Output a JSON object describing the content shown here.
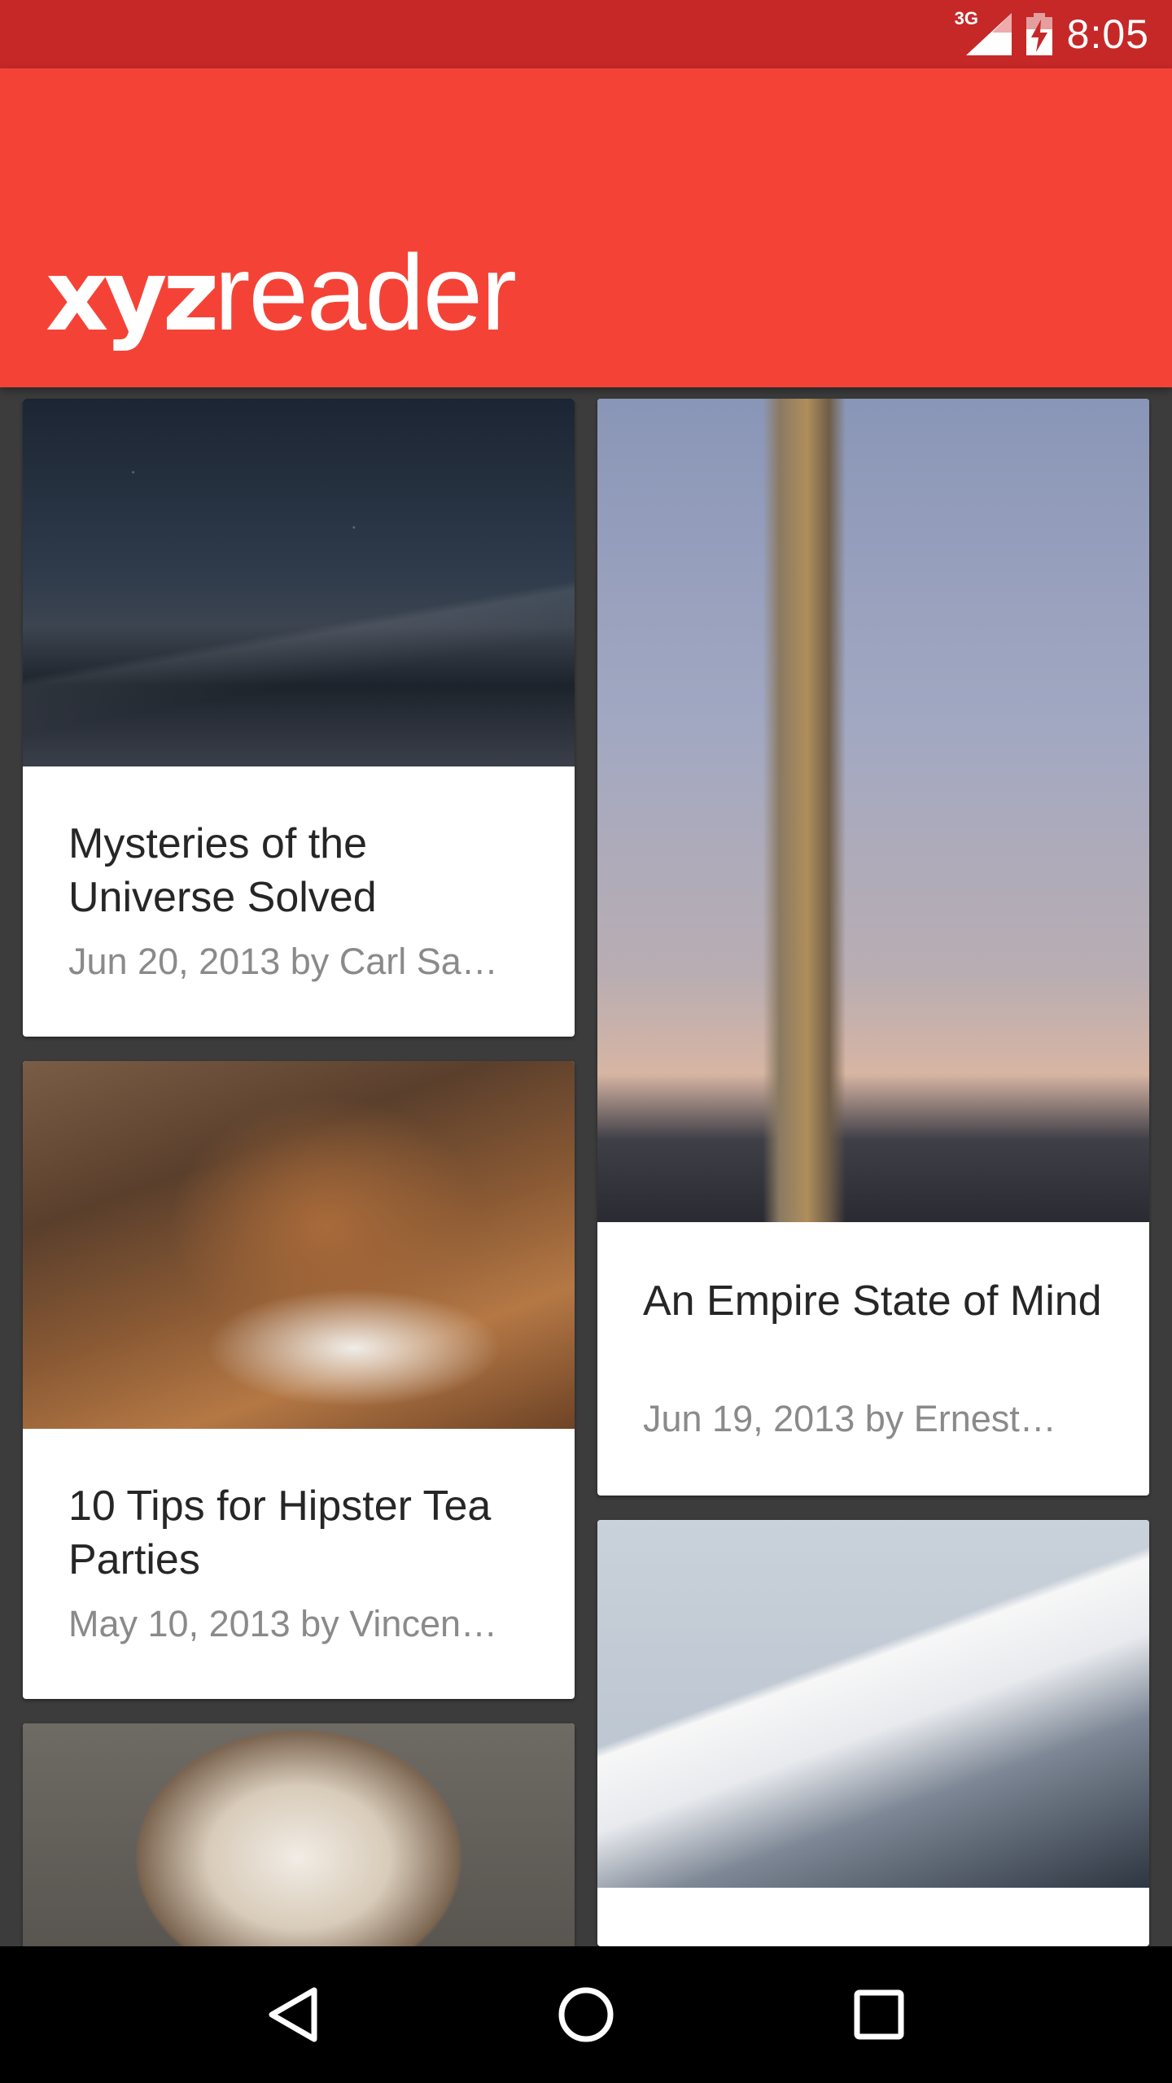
{
  "status_bar": {
    "network": "3G",
    "time": "8:05"
  },
  "app_bar": {
    "logo_bold": "xyz",
    "logo_light": "reader"
  },
  "articles": [
    {
      "title": "Mysteries of the Universe Solved",
      "meta": "Jun 20, 2013 by Carl Sa…",
      "image": "starry-night-mountain"
    },
    {
      "title": "An Empire State of Mind",
      "meta": "Jun 19, 2013 by Ernest…",
      "image": "empire-state-building"
    },
    {
      "title": "10 Tips for Hipster Tea Parties",
      "meta": "May 10, 2013 by Vincen…",
      "image": "tea-cups-table"
    },
    {
      "title": "",
      "meta": "",
      "image": "snowy-mountain"
    },
    {
      "title": "",
      "meta": "",
      "image": "bulldog"
    }
  ],
  "nav_bar": {
    "back_icon": "back-icon",
    "home_icon": "home-icon",
    "recents_icon": "recents-icon"
  },
  "colors": {
    "status_bar": "#c62828",
    "app_bar": "#f44336",
    "background": "#3c3c3c",
    "card": "#ffffff",
    "title_text": "#262626",
    "meta_text": "#8a8a8a"
  }
}
